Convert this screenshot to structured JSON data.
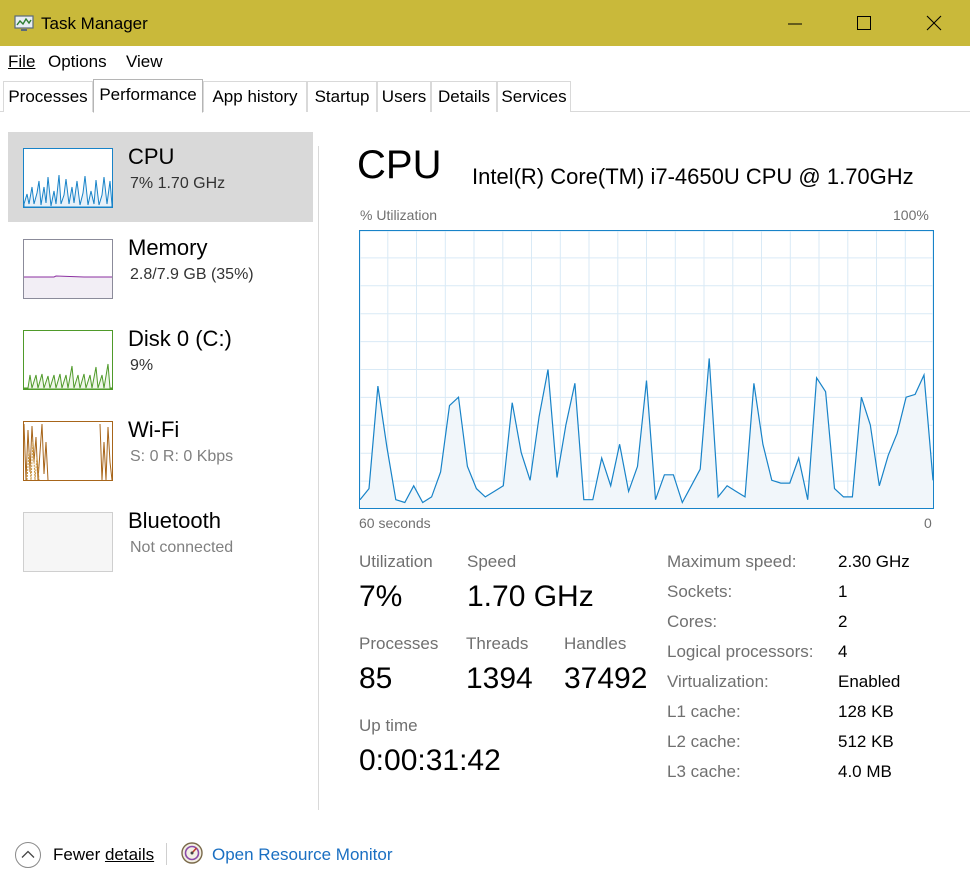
{
  "window": {
    "title": "Task Manager"
  },
  "menu": {
    "file": "File",
    "options": "Options",
    "view": "View"
  },
  "tabs": [
    "Processes",
    "Performance",
    "App history",
    "Startup",
    "Users",
    "Details",
    "Services"
  ],
  "active_tab": "Performance",
  "sidebar": {
    "items": [
      {
        "name": "CPU",
        "sub": "7%  1.70 GHz",
        "color": "#1883c8"
      },
      {
        "name": "Memory",
        "sub": "2.8/7.9 GB (35%)",
        "color": "#8b2fa0"
      },
      {
        "name": "Disk 0 (C:)",
        "sub": "9%",
        "color": "#4f9a2a"
      },
      {
        "name": "Wi-Fi",
        "sub": "S: 0  R: 0 Kbps",
        "color": "#a7651a"
      },
      {
        "name": "Bluetooth",
        "sub": "Not connected",
        "color": "#c0c0c0"
      }
    ]
  },
  "main": {
    "title": "CPU",
    "model": "Intel(R) Core(TM) i7-4650U CPU @ 1.70GHz",
    "graph": {
      "y_label": "% Utilization",
      "y_max_label": "100%",
      "x_left_label": "60 seconds",
      "x_right_label": "0",
      "line_color": "#1883c8",
      "fill_color": "#f1f6fa",
      "grid_color": "#d9eaf6",
      "samples": [
        3,
        7,
        44,
        22,
        3,
        2,
        8,
        2,
        4,
        13,
        37,
        40,
        15,
        7,
        4,
        6,
        8,
        38,
        20,
        10,
        33,
        50,
        11,
        30,
        45,
        3,
        3,
        18,
        8,
        23,
        6,
        15,
        46,
        3,
        12,
        12,
        2,
        8,
        14,
        54,
        4,
        8,
        6,
        4,
        45,
        23,
        10,
        9,
        9,
        18,
        3,
        47,
        42,
        7,
        4,
        4,
        40,
        30,
        8,
        19,
        27,
        40,
        41,
        48,
        10
      ]
    },
    "stats": {
      "utilization_label": "Utilization",
      "utilization": "7%",
      "speed_label": "Speed",
      "speed": "1.70 GHz",
      "processes_label": "Processes",
      "processes": "85",
      "threads_label": "Threads",
      "threads": "1394",
      "handles_label": "Handles",
      "handles": "37492",
      "uptime_label": "Up time",
      "uptime": "0:00:31:42"
    },
    "specs": [
      {
        "label": "Maximum speed:",
        "value": "2.30 GHz"
      },
      {
        "label": "Sockets:",
        "value": "1"
      },
      {
        "label": "Cores:",
        "value": "2"
      },
      {
        "label": "Logical processors:",
        "value": "4"
      },
      {
        "label": "Virtualization:",
        "value": "Enabled"
      },
      {
        "label": "L1 cache:",
        "value": "128 KB"
      },
      {
        "label": "L2 cache:",
        "value": "512 KB"
      },
      {
        "label": "L3 cache:",
        "value": "4.0 MB"
      }
    ]
  },
  "footer": {
    "fewer_details_prefix": "Fewer ",
    "fewer_details_underlined": "details",
    "resource_monitor": "Open Resource Monitor"
  }
}
